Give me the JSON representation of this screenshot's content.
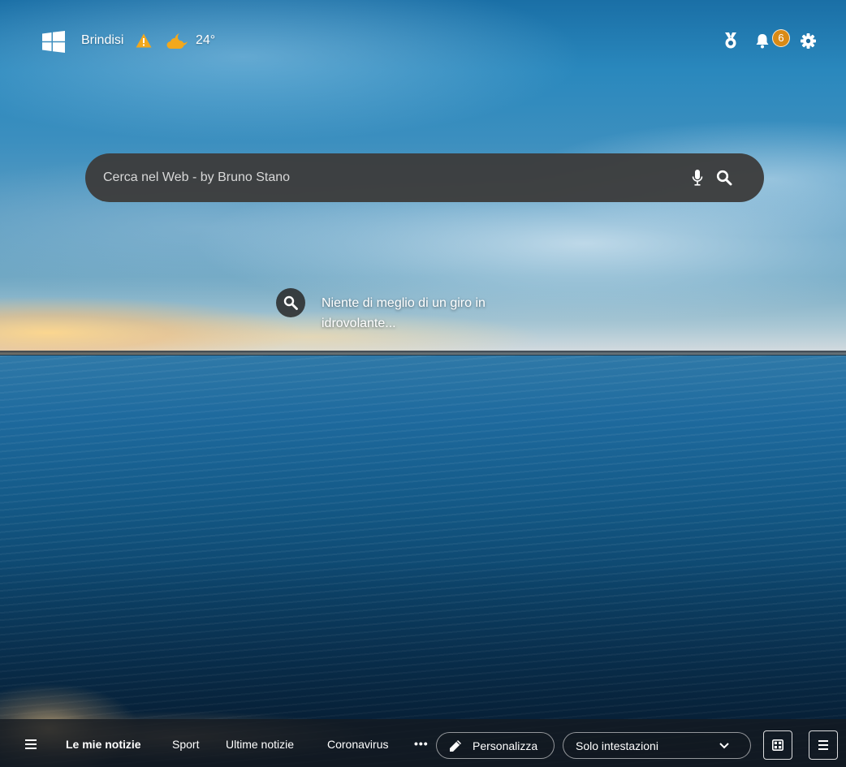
{
  "header": {
    "city": "Brindisi",
    "temperature": "24°",
    "notifications_count": "6",
    "icons": [
      "windows-logo-icon",
      "warning-icon",
      "partly-cloudy-night-icon",
      "medal-icon",
      "bell-icon",
      "gear-icon"
    ]
  },
  "search": {
    "placeholder": "Cerca nel Web - by Bruno Stano",
    "value": ""
  },
  "image_caption": {
    "text": "Niente di meglio di un giro in idrovolante..."
  },
  "bottom_nav": {
    "items": [
      {
        "label": "Le mie notizie",
        "active": true
      },
      {
        "label": "Sport",
        "active": false
      },
      {
        "label": "Ultime notizie",
        "active": false
      },
      {
        "label": "Coronavirus",
        "active": false
      }
    ],
    "more_label": "•••",
    "personalize_label": "Personalizza",
    "layout_select_value": "Solo intestazioni"
  },
  "colors": {
    "badge": "#d98a16",
    "warning": "#f2a81d",
    "weather": "#f2a81d",
    "searchbar": "#3c3c3c"
  }
}
